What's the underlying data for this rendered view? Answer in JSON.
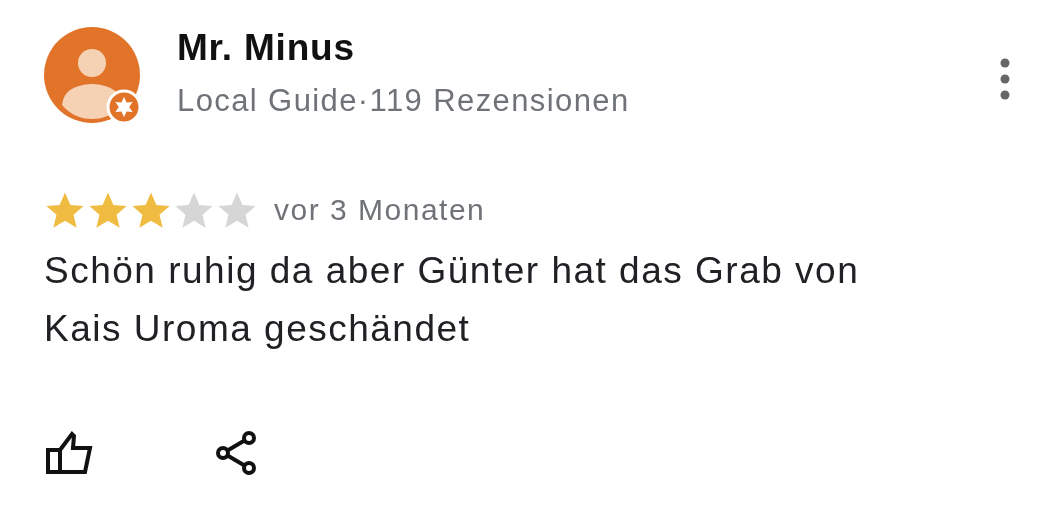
{
  "reviewer": {
    "name": "Mr. Minus",
    "subtitle": "Local Guide·119 Rezensionen",
    "local_guide": true
  },
  "review": {
    "stars": 3,
    "time": "vor 3 Monaten",
    "text": "Schön ruhig da aber Günter hat das Grab von Kais Uroma geschändet"
  }
}
